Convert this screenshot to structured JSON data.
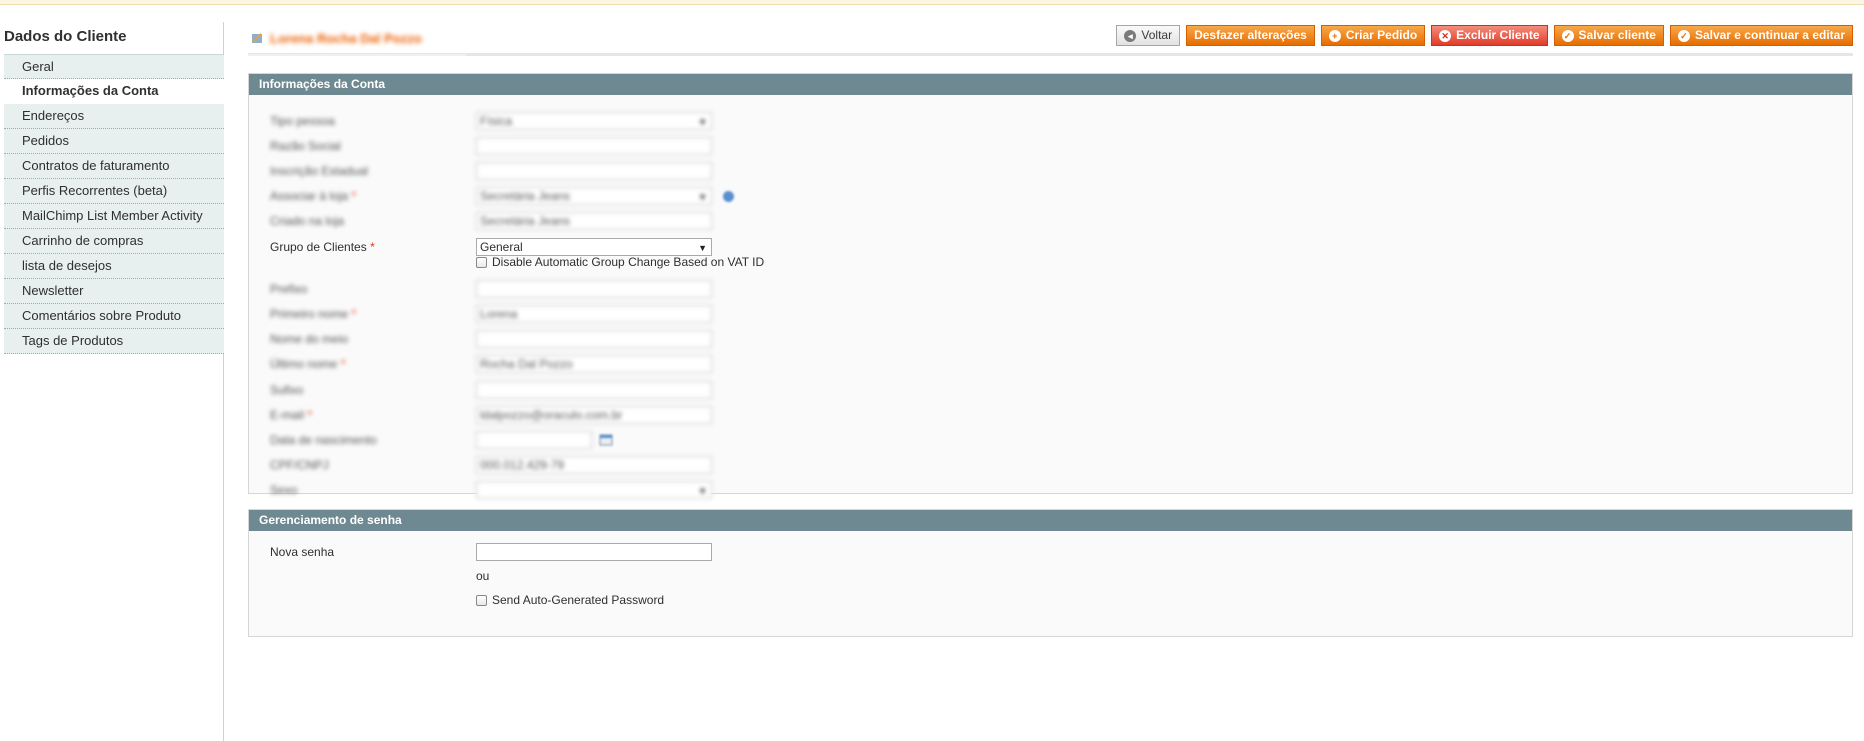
{
  "sidebar": {
    "title": "Dados do Cliente",
    "items": [
      {
        "label": "Geral",
        "active": false
      },
      {
        "label": "Informações da Conta",
        "active": true
      },
      {
        "label": "Endereços",
        "active": false
      },
      {
        "label": "Pedidos",
        "active": false
      },
      {
        "label": "Contratos de faturamento",
        "active": false
      },
      {
        "label": "Perfis Recorrentes (beta)",
        "active": false
      },
      {
        "label": "MailChimp List Member Activity",
        "active": false
      },
      {
        "label": "Carrinho de compras",
        "active": false
      },
      {
        "label": "lista de desejos",
        "active": false
      },
      {
        "label": "Newsletter",
        "active": false
      },
      {
        "label": "Comentários sobre Produto",
        "active": false
      },
      {
        "label": "Tags de Produtos",
        "active": false
      }
    ]
  },
  "header": {
    "title": "Lorena Rocha Dal Pozzo",
    "buttons": {
      "back": "Voltar",
      "reset": "Desfazer alterações",
      "create_order": "Criar Pedido",
      "delete": "Excluir Cliente",
      "save": "Salvar cliente",
      "save_continue": "Salvar e continuar a editar"
    }
  },
  "account": {
    "legend": "Informações da Conta",
    "fields": {
      "tipo_pessoa": {
        "label": "Tipo pessoa",
        "value": "Física"
      },
      "razao_social": {
        "label": "Razão Social",
        "value": ""
      },
      "inscricao_estadual": {
        "label": "Inscrição Estadual",
        "value": ""
      },
      "associar_loja": {
        "label": "Associar à loja",
        "value": "Secretária Jeans"
      },
      "criado_loja": {
        "label": "Criado na loja",
        "value": "Secretária Jeans"
      },
      "grupo_clientes": {
        "label": "Grupo de Clientes",
        "value": "General"
      },
      "vat_checkbox": "Disable Automatic Group Change Based on VAT ID",
      "prefixo": {
        "label": "Prefixo",
        "value": ""
      },
      "primeiro_nome": {
        "label": "Primeiro nome",
        "value": "Lorena"
      },
      "nome_meio": {
        "label": "Nome do meio",
        "value": ""
      },
      "ultimo_nome": {
        "label": "Último nome",
        "value": "Rocha Dal Pozzo"
      },
      "sufixo": {
        "label": "Sufixo",
        "value": ""
      },
      "email": {
        "label": "E-mail",
        "value": "ldalpozzo@oraculo.com.br"
      },
      "data_nascimento": {
        "label": "Data de nascimento",
        "value": ""
      },
      "cpf_cnpj": {
        "label": "CPF/CNPJ",
        "value": "000.012.429-79"
      },
      "sexo": {
        "label": "Sexo",
        "value": ""
      }
    }
  },
  "password": {
    "legend": "Gerenciamento de senha",
    "new_password_label": "Nova senha",
    "new_password_value": "",
    "or_text": "ou",
    "auto_checkbox": "Send Auto-Generated Password"
  },
  "colors": {
    "accent_orange": "#e66c00",
    "fieldset_header": "#6f8992",
    "sidebar_bg": "#e7efef",
    "delete_red": "#e03c2a",
    "required": "#eb340a"
  }
}
